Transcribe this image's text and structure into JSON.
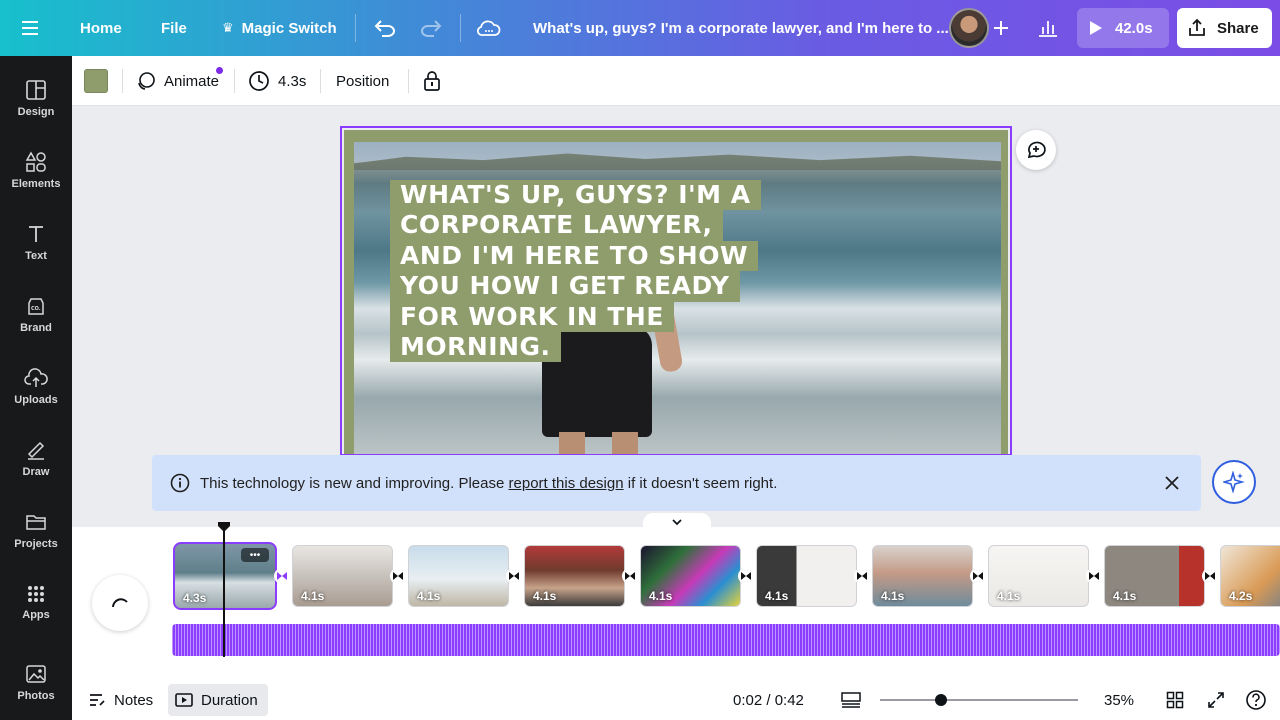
{
  "topbar": {
    "home": "Home",
    "file": "File",
    "magic_switch": "Magic Switch",
    "design_title": "What's up, guys? I'm a corporate lawyer, and I'm here to ...",
    "play_duration": "42.0s",
    "share": "Share"
  },
  "sidebar": {
    "items": [
      {
        "label": "Design",
        "icon": "design-icon"
      },
      {
        "label": "Elements",
        "icon": "elements-icon"
      },
      {
        "label": "Text",
        "icon": "text-icon"
      },
      {
        "label": "Brand",
        "icon": "brand-icon"
      },
      {
        "label": "Uploads",
        "icon": "uploads-icon"
      },
      {
        "label": "Draw",
        "icon": "draw-icon"
      },
      {
        "label": "Projects",
        "icon": "projects-icon"
      },
      {
        "label": "Apps",
        "icon": "apps-icon"
      },
      {
        "label": "Photos",
        "icon": "photos-icon"
      }
    ]
  },
  "toolbar": {
    "swatch_color": "#8f9d6c",
    "animate": "Animate",
    "duration": "4.3s",
    "position": "Position"
  },
  "canvas": {
    "title_lines": [
      "WHAT'S UP, GUYS? I'M A",
      "CORPORATE LAWYER,",
      "AND I'M HERE TO SHOW",
      "YOU HOW I GET READY",
      "FOR WORK IN THE",
      "MORNING."
    ],
    "frame_color": "#8f9d6c"
  },
  "banner": {
    "text_before": "This technology is new and improving. Please ",
    "link": "report this design",
    "text_after": " if it doesn't seem right."
  },
  "timeline": {
    "clips": [
      {
        "duration": "4.3s",
        "selected": true,
        "bg": "linear-gradient(180deg,#7f96a6,#5f7f8a 45%,#d7dfe2 60%,#9aa8ad)"
      },
      {
        "duration": "4.1s",
        "selected": false,
        "bg": "linear-gradient(180deg,#e9e6e2,#c8c2bc 50%,#a99c91)"
      },
      {
        "duration": "4.1s",
        "selected": false,
        "bg": "linear-gradient(180deg,#c9dcea,#e8eef2 55%,#bfb7a6)"
      },
      {
        "duration": "4.1s",
        "selected": false,
        "bg": "linear-gradient(180deg,#b23a3a,#6f3a2e 40%,#c7a38a 70%,#3b3b3b)"
      },
      {
        "duration": "4.1s",
        "selected": false,
        "bg": "linear-gradient(135deg,#1c1330,#2f6f3a 30%,#c73ab8 55%,#2a8fd1 75%,#e6d23a)"
      },
      {
        "duration": "4.1s",
        "selected": false,
        "bg": "linear-gradient(90deg,#3a3a3a 0 40%,#f2f0ee 40%)"
      },
      {
        "duration": "4.1s",
        "selected": false,
        "bg": "linear-gradient(180deg,#d8d2cc,#c49a86 45%,#6f8c9c)"
      },
      {
        "duration": "4.1s",
        "selected": false,
        "bg": "linear-gradient(180deg,#f6f5f3,#ebe9e6)"
      },
      {
        "duration": "4.1s",
        "selected": false,
        "bg": "linear-gradient(90deg,#8d8780 0 75%,#b8322c 75%)"
      },
      {
        "duration": "4.2s",
        "selected": false,
        "bg": "linear-gradient(135deg,#f0e6d8,#d99a55 50%,#3b6fa8)"
      }
    ]
  },
  "footer": {
    "notes": "Notes",
    "duration": "Duration",
    "time": "0:02 / 0:42",
    "zoom": "35%"
  }
}
